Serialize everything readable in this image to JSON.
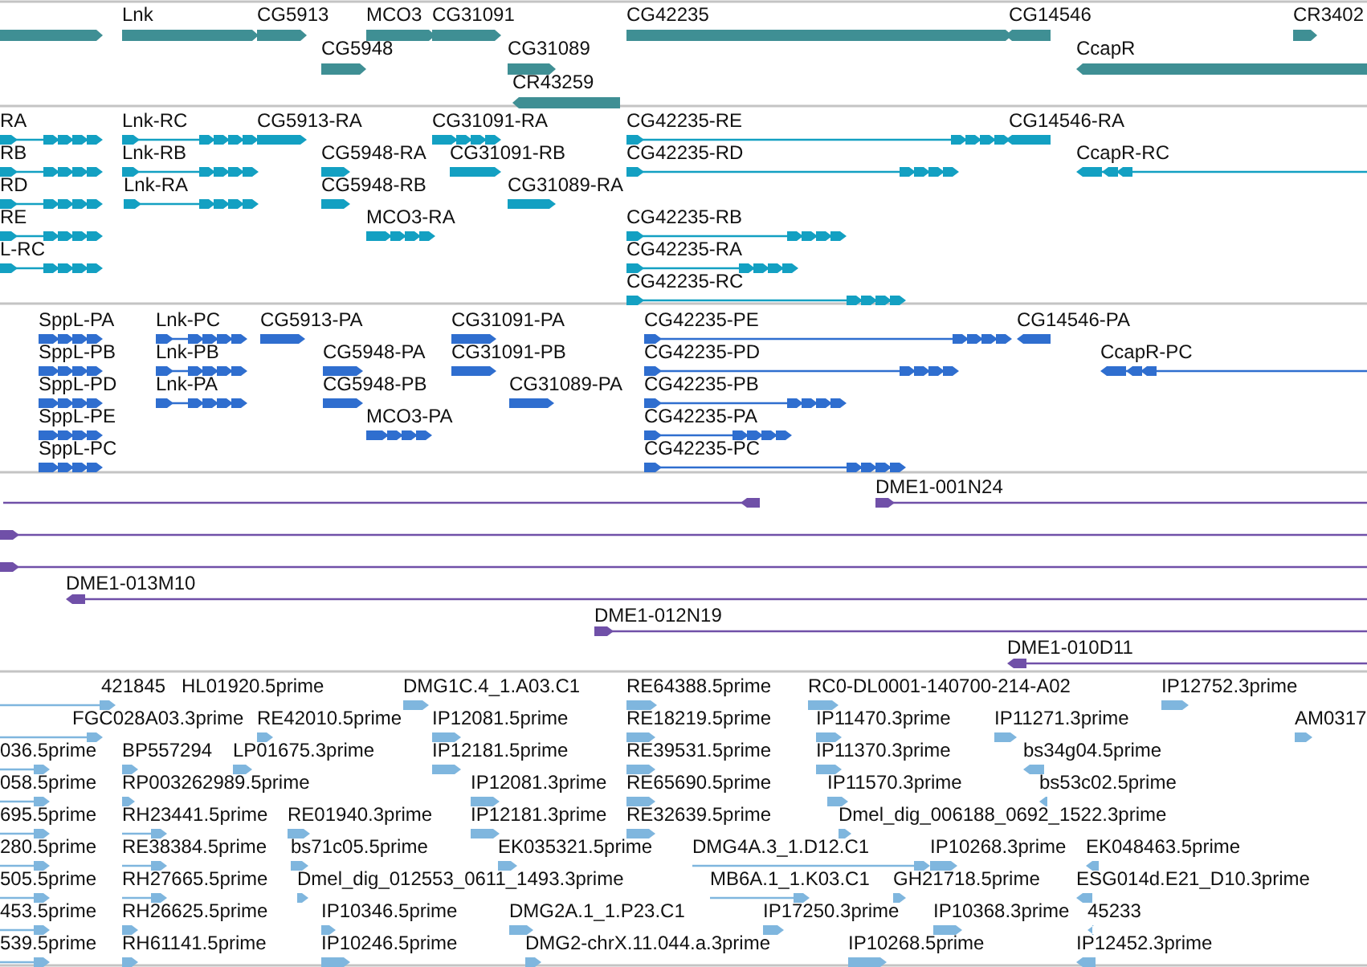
{
  "tracks": [
    {
      "kind": "genes",
      "features": [
        {
          "reverse": false
        },
        {
          "label": "Lnk",
          "reverse": false
        },
        {
          "label": "CG5913",
          "reverse": false
        },
        {
          "label": "MCO3",
          "reverse": false
        },
        {
          "label": "CG31091",
          "reverse": false
        },
        {
          "label": "CG42235",
          "reverse": false
        },
        {
          "label": "CG14546",
          "reverse": true
        },
        {
          "label": "CR3402",
          "reverse": false
        },
        {
          "label": "CG5948",
          "reverse": false
        },
        {
          "label": "CG31089",
          "reverse": false
        },
        {
          "label": "CcapR",
          "reverse": true
        },
        {
          "label": "CR43259",
          "reverse": true
        }
      ]
    },
    {
      "kind": "transcripts",
      "features": [
        {
          "label": "RA",
          "reverse": false
        },
        {
          "label": "Lnk-RC",
          "reverse": false
        },
        {
          "label": "CG5913-RA",
          "reverse": false
        },
        {
          "label": "CG31091-RA",
          "reverse": false
        },
        {
          "label": "CG42235-RE",
          "reverse": false
        },
        {
          "label": "CG14546-RA",
          "reverse": true
        },
        {
          "label": "RB",
          "reverse": false
        },
        {
          "label": "Lnk-RB",
          "reverse": false
        },
        {
          "label": "CG5948-RA",
          "reverse": false
        },
        {
          "label": "CG31091-RB",
          "reverse": false
        },
        {
          "label": "CG42235-RD",
          "reverse": false
        },
        {
          "label": "CcapR-RC",
          "reverse": true
        },
        {
          "label": "RD",
          "reverse": false
        },
        {
          "label": "Lnk-RA",
          "reverse": false
        },
        {
          "label": "CG5948-RB",
          "reverse": false
        },
        {
          "label": "CG31089-RA",
          "reverse": false
        },
        {
          "label": "RE",
          "reverse": false
        },
        {
          "label": "MCO3-RA",
          "reverse": false
        },
        {
          "label": "CG42235-RB",
          "reverse": false
        },
        {
          "label": "L-RC",
          "reverse": false
        },
        {
          "label": "CG42235-RA",
          "reverse": false
        },
        {
          "label": "CG42235-RC",
          "reverse": false
        }
      ]
    },
    {
      "kind": "proteins",
      "features": [
        {
          "label": "SppL-PA",
          "reverse": false
        },
        {
          "label": "Lnk-PC",
          "reverse": false
        },
        {
          "label": "CG5913-PA",
          "reverse": false
        },
        {
          "label": "CG31091-PA",
          "reverse": false
        },
        {
          "label": "CG42235-PE",
          "reverse": false
        },
        {
          "label": "CG14546-PA",
          "reverse": true
        },
        {
          "label": "SppL-PB",
          "reverse": false
        },
        {
          "label": "Lnk-PB",
          "reverse": false
        },
        {
          "label": "CG5948-PA",
          "reverse": false
        },
        {
          "label": "CG31091-PB",
          "reverse": false
        },
        {
          "label": "CG42235-PD",
          "reverse": false
        },
        {
          "label": "CcapR-PC",
          "reverse": true
        },
        {
          "label": "SppL-PD",
          "reverse": false
        },
        {
          "label": "Lnk-PA",
          "reverse": false
        },
        {
          "label": "CG5948-PB",
          "reverse": false
        },
        {
          "label": "CG31089-PA",
          "reverse": false
        },
        {
          "label": "CG42235-PB",
          "reverse": false
        },
        {
          "label": "SppL-PE",
          "reverse": false
        },
        {
          "label": "MCO3-PA",
          "reverse": false
        },
        {
          "label": "CG42235-PA",
          "reverse": false
        },
        {
          "label": "SppL-PC",
          "reverse": false
        },
        {
          "label": "CG42235-PC",
          "reverse": false
        }
      ]
    },
    {
      "kind": "clones",
      "features": [
        {
          "reverse": true
        },
        {
          "label": "DME1-001N24",
          "reverse": false
        },
        {
          "reverse": false
        },
        {
          "reverse": false
        },
        {
          "label": "DME1-013M10",
          "reverse": true
        },
        {
          "label": "DME1-012N19",
          "reverse": false
        },
        {
          "label": "DME1-010D11",
          "reverse": true
        }
      ]
    },
    {
      "kind": "ests",
      "features": [
        {
          "label": "421845",
          "reverse": false
        },
        {
          "label": "HL01920.5prime"
        },
        {
          "label": "DMG1C.4_1.A03.C1",
          "reverse": false
        },
        {
          "label": "RE64388.5prime",
          "reverse": false
        },
        {
          "label": "RC0-DL0001-140700-214-A02",
          "reverse": false
        },
        {
          "label": "IP12752.3prime",
          "reverse": false
        },
        {
          "label": "FGC028A03.3prime",
          "reverse": false
        },
        {
          "label": "RE42010.5prime",
          "reverse": false
        },
        {
          "label": "IP12081.5prime",
          "reverse": false
        },
        {
          "label": "RE18219.5prime",
          "reverse": false
        },
        {
          "label": "IP11470.3prime",
          "reverse": false
        },
        {
          "label": "IP11271.3prime",
          "reverse": false
        },
        {
          "label": "AM0317",
          "reverse": false
        },
        {
          "label": "036.5prime",
          "reverse": false
        },
        {
          "label": "BP557294",
          "reverse": false
        },
        {
          "label": "LP01675.3prime",
          "reverse": false
        },
        {
          "label": "IP12181.5prime",
          "reverse": false
        },
        {
          "label": "RE39531.5prime",
          "reverse": false
        },
        {
          "label": "IP11370.3prime",
          "reverse": false
        },
        {
          "label": "bs34g04.5prime",
          "reverse": true
        },
        {
          "label": "058.5prime",
          "reverse": false
        },
        {
          "label": "RP003262989.5prime",
          "reverse": false
        },
        {
          "label": "IP12081.3prime",
          "reverse": false
        },
        {
          "label": "RE65690.5prime",
          "reverse": false
        },
        {
          "label": "IP11570.3prime",
          "reverse": false
        },
        {
          "label": "bs53c02.5prime",
          "reverse": true
        },
        {
          "label": "695.5prime",
          "reverse": false
        },
        {
          "label": "RH23441.5prime",
          "reverse": false
        },
        {
          "label": "RE01940.3prime",
          "reverse": false
        },
        {
          "label": "IP12181.3prime",
          "reverse": false
        },
        {
          "label": "RE32639.5prime",
          "reverse": false
        },
        {
          "label": "Dmel_dig_006188_0692_1522.3prime",
          "reverse": false
        },
        {
          "label": "280.5prime",
          "reverse": false
        },
        {
          "label": "RE38384.5prime",
          "reverse": false
        },
        {
          "label": "bs71c05.5prime",
          "reverse": false
        },
        {
          "label": "EK035321.5prime",
          "reverse": false
        },
        {
          "label": "DMG4A.3_1.D12.C1",
          "reverse": false
        },
        {
          "label": "IP10268.3prime",
          "reverse": false
        },
        {
          "label": "EK048463.5prime",
          "reverse": true
        },
        {
          "label": "505.5prime",
          "reverse": false
        },
        {
          "label": "RH27665.5prime",
          "reverse": false
        },
        {
          "label": "Dmel_dig_012553_0611_1493.3prime",
          "reverse": false
        },
        {
          "label": "MB6A.1_1.K03.C1",
          "reverse": false
        },
        {
          "label": "GH21718.5prime",
          "reverse": false
        },
        {
          "label": "ESG014d.E21_D10.3prime",
          "reverse": true
        },
        {
          "label": "453.5prime",
          "reverse": false
        },
        {
          "label": "RH26625.5prime",
          "reverse": false
        },
        {
          "label": "IP10346.5prime",
          "reverse": false
        },
        {
          "label": "DMG2A.1_1.P23.C1",
          "reverse": false
        },
        {
          "label": "IP17250.3prime",
          "reverse": false
        },
        {
          "label": "IP10368.3prime",
          "reverse": false
        },
        {
          "label": "45233",
          "reverse": true
        },
        {
          "label": "539.5prime",
          "reverse": false
        },
        {
          "label": "RH61141.5prime",
          "reverse": false
        },
        {
          "label": "IP10246.5prime",
          "reverse": false
        },
        {
          "label": "DMG2-chrX.11.044.a.3prime",
          "reverse": false
        },
        {
          "label": "IP10268.5prime",
          "reverse": false
        },
        {
          "label": "IP12452.3prime",
          "reverse": true
        }
      ]
    }
  ]
}
